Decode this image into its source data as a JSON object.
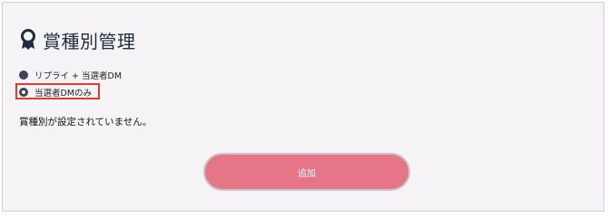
{
  "header": {
    "icon": "award-ribbon-icon",
    "title": "賞種別管理"
  },
  "options": [
    {
      "label": "リプライ + 当選者DM",
      "selected": false
    },
    {
      "label": "当選者DMのみ",
      "selected": true
    }
  ],
  "message": "賞種別が設定されていません。",
  "add_button": {
    "label": "追加"
  },
  "colors": {
    "panel_bg": "#f5f3f5",
    "button_bg": "#e67588",
    "radio": "#3b4558",
    "highlight": "#e53a2e"
  }
}
